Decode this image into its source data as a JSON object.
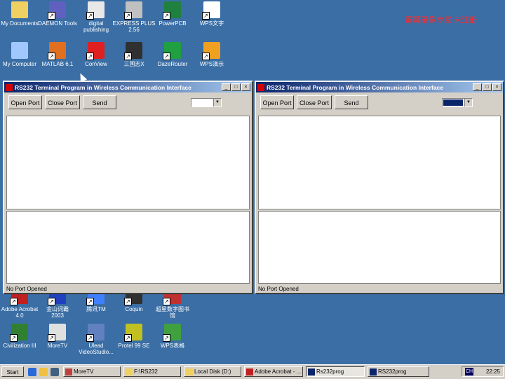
{
  "desktop": {
    "watermark": "屏幕录像专家 未注册",
    "icons": [
      {
        "label": "My Documents",
        "icon": "my-documents-icon",
        "color": "#f0d060"
      },
      {
        "label": "DAEMON Tools",
        "icon": "daemon-tools-icon",
        "color": "#6060c0"
      },
      {
        "label": "digital\npublishing",
        "icon": "publishing-icon",
        "color": "#e8e8e8"
      },
      {
        "label": "EXPRESS PLUS\n2.56",
        "icon": "express-plus-icon",
        "color": "#c0c0c0"
      },
      {
        "label": "PowerPCB",
        "icon": "powerpcb-icon",
        "color": "#208040"
      },
      {
        "label": "WPS文字",
        "icon": "wps-text-icon",
        "color": "#ffffff"
      },
      {
        "label": "My Computer",
        "icon": "my-computer-icon",
        "color": "#a0c8ff"
      },
      {
        "label": "MATLAB 6.1",
        "icon": "matlab-icon",
        "color": "#e07020"
      },
      {
        "label": "ConView",
        "icon": "conview-icon",
        "color": "#e02020"
      },
      {
        "label": "三国志X",
        "icon": "sanguo-icon",
        "color": "#303030"
      },
      {
        "label": "DazeRouter",
        "icon": "dazerouter-icon",
        "color": "#20a040"
      },
      {
        "label": "WPS演示",
        "icon": "wps-presentation-icon",
        "color": "#f0a020"
      },
      {
        "label": "Adobe Acrobat\n4.0",
        "icon": "acrobat-icon",
        "color": "#c02020"
      },
      {
        "label": "金山词霸\n2003",
        "icon": "jinshan-icon",
        "color": "#2040c0"
      },
      {
        "label": "腾讯TM",
        "icon": "tencent-tm-icon",
        "color": "#4080ff"
      },
      {
        "label": "Coquin",
        "icon": "coquin-icon",
        "color": "#303030"
      },
      {
        "label": "超星数字图书\n馆",
        "icon": "chaoxing-icon",
        "color": "#c03030"
      },
      {
        "label": "Civilization III",
        "icon": "civilization-icon",
        "color": "#308030"
      },
      {
        "label": "MoreTV",
        "icon": "moretv-icon",
        "color": "#e0e0e0"
      },
      {
        "label": "Ulead\nVideoStudio...",
        "icon": "ulead-icon",
        "color": "#6080c0"
      },
      {
        "label": "Protel 99 SE",
        "icon": "protel-icon",
        "color": "#c0c020"
      },
      {
        "label": "WPS表格",
        "icon": "wps-table-icon",
        "color": "#40a040"
      }
    ]
  },
  "windows": [
    {
      "title": "RS232 Terminal Program in Wireless Communication Interface",
      "buttons": {
        "open": "Open Port",
        "close": "Close Port",
        "send": "Send"
      },
      "combo_selected": false,
      "status": "No Port Opened"
    },
    {
      "title": "RS232 Terminal Program in Wireless Communication Interface",
      "buttons": {
        "open": "Open Port",
        "close": "Close Port",
        "send": "Send"
      },
      "combo_selected": true,
      "status": "No Port Opened"
    }
  ],
  "taskbar": {
    "start": "Start",
    "quicklaunch": [
      "ie-icon",
      "outlook-icon",
      "desktop-icon"
    ],
    "tasks": [
      {
        "label": "MoreTV",
        "icon": "moretv-icon",
        "color": "#c04040",
        "active": false
      },
      {
        "label": "F:\\RS232",
        "icon": "folder-icon",
        "color": "#f0d060",
        "active": false
      },
      {
        "label": "Local Disk (D:)",
        "icon": "disk-icon",
        "color": "#f0d060",
        "active": false
      },
      {
        "label": "Adobe Acrobat - ...",
        "icon": "acrobat-icon",
        "color": "#c02020",
        "active": false
      },
      {
        "label": "Rs232prog",
        "icon": "app-icon",
        "color": "#0a246a",
        "active": true
      },
      {
        "label": "RS232prog",
        "icon": "app-icon",
        "color": "#0a246a",
        "active": false
      }
    ],
    "tray": {
      "lang": "CH",
      "clock": "22:25"
    }
  }
}
